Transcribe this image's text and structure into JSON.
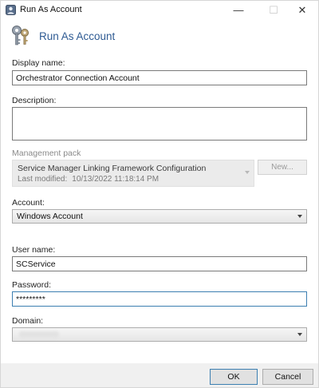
{
  "window": {
    "title": "Run As Account",
    "minimize_glyph": "—",
    "maximize_glyph": "☐",
    "close_glyph": "✕",
    "icons": {
      "app": "run-as-icon",
      "header": "keys-icon"
    }
  },
  "header": {
    "title": "Run As Account"
  },
  "form": {
    "display_name": {
      "label": "Display name:",
      "value": "Orchestrator Connection Account"
    },
    "description": {
      "label": "Description:",
      "value": ""
    },
    "management_pack": {
      "label": "Management pack",
      "name": "Service Manager Linking Framework Configuration",
      "last_modified_label": "Last modified:",
      "last_modified_value": "10/13/2022 11:18:14 PM",
      "new_button_label": "New..."
    },
    "account": {
      "label": "Account:",
      "selected": "Windows Account"
    },
    "user_name": {
      "label": "User name:",
      "value": "SCService"
    },
    "password": {
      "label": "Password:",
      "value": "*********"
    },
    "domain": {
      "label": "Domain:",
      "selected": ""
    }
  },
  "buttons": {
    "ok": "OK",
    "cancel": "Cancel"
  },
  "colors": {
    "header_title": "#2f5b93",
    "focus_border": "#3c7fb1"
  }
}
